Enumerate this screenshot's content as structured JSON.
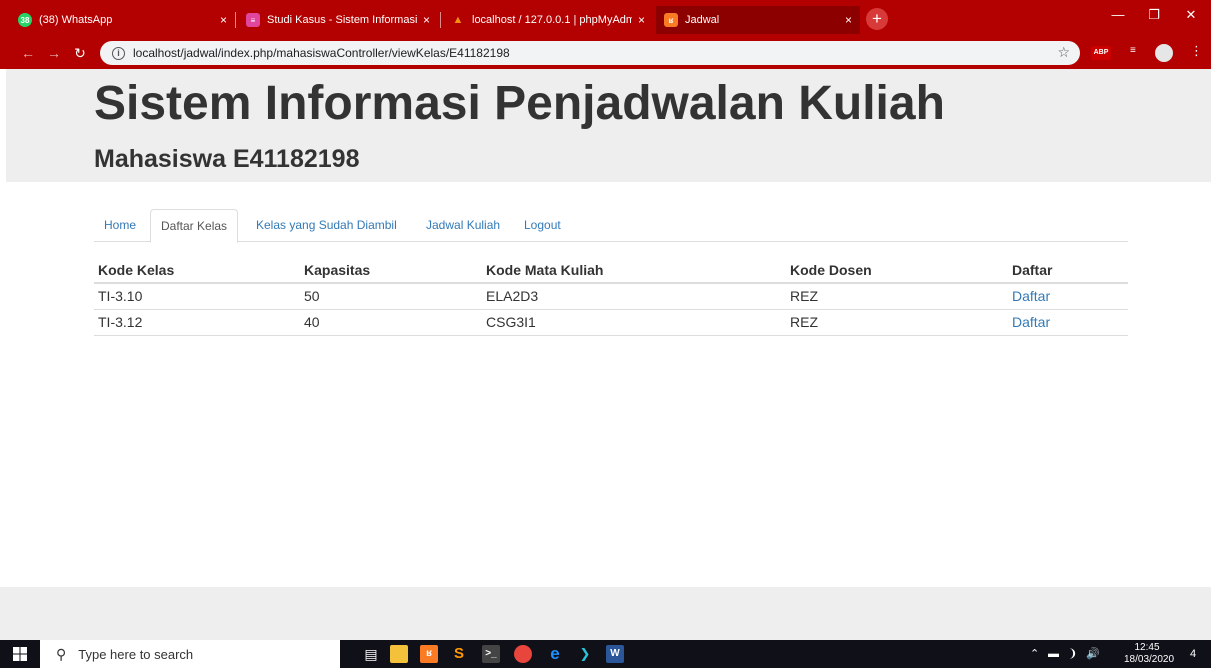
{
  "browser": {
    "tabs": [
      {
        "label": "(38) WhatsApp",
        "favicon": "whatsapp-icon",
        "color": "#25d366",
        "badge": "38"
      },
      {
        "label": "Studi Kasus - Sistem Informasi Se",
        "favicon": "classroom-icon",
        "color": "#e0469c",
        "badge": "≡"
      },
      {
        "label": "localhost / 127.0.0.1 | phpMyAdm",
        "favicon": "phpmyadmin-icon",
        "color": "#f29111",
        "badge": "▲"
      },
      {
        "label": "Jadwal",
        "favicon": "xampp-icon",
        "color": "#fb7a24",
        "badge": "ʁ"
      }
    ],
    "close_glyph": "×",
    "new_tab_glyph": "+",
    "url": "localhost/jadwal/index.php/mahasiswaController/viewKelas/E41182198",
    "ext_abp": "ABP"
  },
  "page": {
    "title": "Sistem Informasi Penjadwalan Kuliah",
    "subtitle": "Mahasiswa E41182198",
    "nav": [
      "Home",
      "Daftar Kelas",
      "Kelas yang Sudah Diambil",
      "Jadwal Kuliah",
      "Logout"
    ],
    "active_nav": "Daftar Kelas",
    "table": {
      "headers": [
        "Kode Kelas",
        "Kapasitas",
        "Kode Mata Kuliah",
        "Kode Dosen",
        "Daftar"
      ],
      "rows": [
        [
          "TI-3.10",
          "50",
          "ELA2D3",
          "REZ",
          "Daftar"
        ],
        [
          "TI-3.12",
          "40",
          "CSG3I1",
          "REZ",
          "Daftar"
        ]
      ]
    }
  },
  "taskbar": {
    "search_placeholder": "Type here to search",
    "time": "12:45",
    "date": "18/03/2020",
    "notifications": "4"
  },
  "colors": {
    "chrome_red": "#b30000",
    "link_blue": "#337ab7",
    "jumbotron_bg": "#eeeeee"
  }
}
